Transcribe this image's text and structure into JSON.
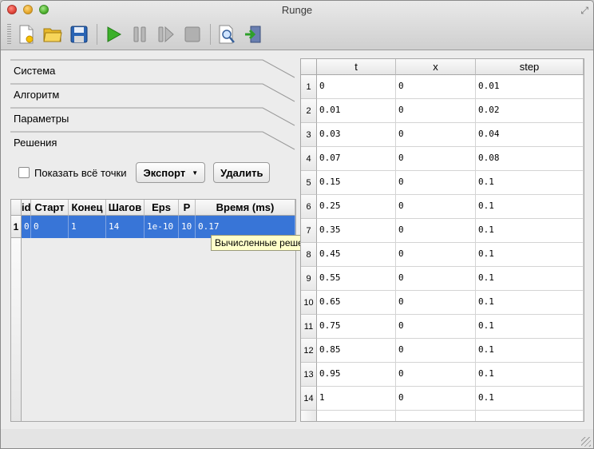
{
  "window": {
    "title": "Runge"
  },
  "toolbar": {
    "icons": [
      "new-document-icon",
      "open-folder-icon",
      "save-disk-icon",
      "play-icon",
      "pause-icon",
      "step-forward-icon",
      "stop-icon",
      "preview-zoom-icon",
      "exit-icon"
    ]
  },
  "sections": [
    {
      "label": "Система"
    },
    {
      "label": "Алгоритм"
    },
    {
      "label": "Параметры"
    },
    {
      "label": "Решения"
    }
  ],
  "controls": {
    "show_all_points_label": "Показать всё точки",
    "export_label": "Экспорт",
    "delete_label": "Удалить"
  },
  "solutions": {
    "columns": [
      "id",
      "Старт",
      "Конец",
      "Шагов",
      "Eps",
      "P",
      "Время (ms)"
    ],
    "rows": [
      {
        "num": "1",
        "cells": [
          "0",
          "0",
          "1",
          "14",
          "1e-10",
          "10",
          "0.17"
        ]
      }
    ],
    "tooltip": "Вычисленные решения"
  },
  "results": {
    "columns": [
      "t",
      "x",
      "step"
    ],
    "rows": [
      {
        "num": "1",
        "t": "0",
        "x": "0",
        "step": "0.01"
      },
      {
        "num": "2",
        "t": "0.01",
        "x": "0",
        "step": "0.02"
      },
      {
        "num": "3",
        "t": "0.03",
        "x": "0",
        "step": "0.04"
      },
      {
        "num": "4",
        "t": "0.07",
        "x": "0",
        "step": "0.08"
      },
      {
        "num": "5",
        "t": "0.15",
        "x": "0",
        "step": "0.1"
      },
      {
        "num": "6",
        "t": "0.25",
        "x": "0",
        "step": "0.1"
      },
      {
        "num": "7",
        "t": "0.35",
        "x": "0",
        "step": "0.1"
      },
      {
        "num": "8",
        "t": "0.45",
        "x": "0",
        "step": "0.1"
      },
      {
        "num": "9",
        "t": "0.55",
        "x": "0",
        "step": "0.1"
      },
      {
        "num": "10",
        "t": "0.65",
        "x": "0",
        "step": "0.1"
      },
      {
        "num": "11",
        "t": "0.75",
        "x": "0",
        "step": "0.1"
      },
      {
        "num": "12",
        "t": "0.85",
        "x": "0",
        "step": "0.1"
      },
      {
        "num": "13",
        "t": "0.95",
        "x": "0",
        "step": "0.1"
      },
      {
        "num": "14",
        "t": "1",
        "x": "0",
        "step": "0.1"
      }
    ]
  },
  "colors": {
    "selection": "#3875d7",
    "tooltip_bg": "#ffffca"
  }
}
